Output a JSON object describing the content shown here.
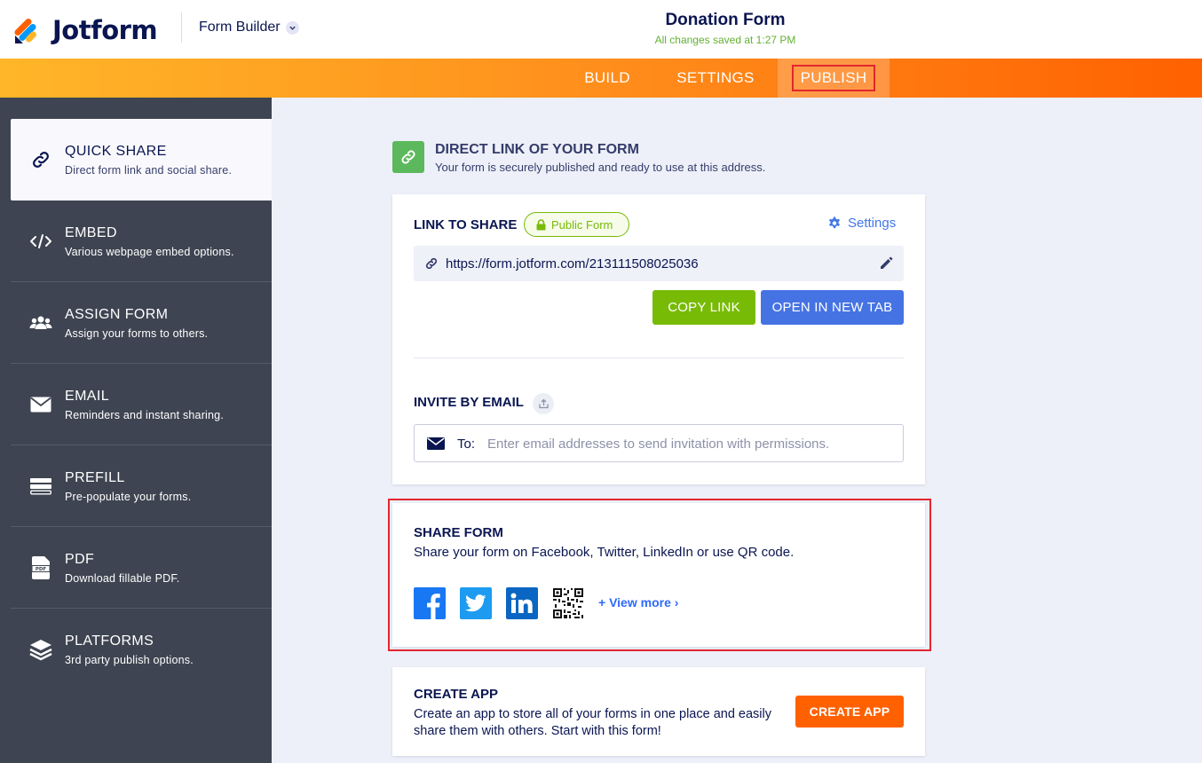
{
  "header": {
    "logo_text": "Jotform",
    "mode_label": "Form Builder",
    "form_title": "Donation Form",
    "save_status": "All changes saved at 1:27 PM"
  },
  "nav": {
    "tabs": [
      {
        "label": "BUILD"
      },
      {
        "label": "SETTINGS"
      },
      {
        "label": "PUBLISH",
        "active": true
      }
    ]
  },
  "sidebar": {
    "items": [
      {
        "title": "QUICK SHARE",
        "subtitle": "Direct form link and social share.",
        "icon": "link-icon",
        "active": true
      },
      {
        "title": "EMBED",
        "subtitle": "Various webpage embed options.",
        "icon": "code-icon"
      },
      {
        "title": "ASSIGN FORM",
        "subtitle": "Assign your forms to others.",
        "icon": "users-icon"
      },
      {
        "title": "EMAIL",
        "subtitle": "Reminders and instant sharing.",
        "icon": "envelope-icon"
      },
      {
        "title": "PREFILL",
        "subtitle": "Pre-populate your forms.",
        "icon": "prefill-icon"
      },
      {
        "title": "PDF",
        "subtitle": "Download fillable PDF.",
        "icon": "pdf-icon"
      },
      {
        "title": "PLATFORMS",
        "subtitle": "3rd party publish options.",
        "icon": "layers-icon"
      }
    ]
  },
  "direct_link": {
    "title": "DIRECT LINK OF YOUR FORM",
    "subtitle": "Your form is securely published and ready to use at this address."
  },
  "link_card": {
    "label": "LINK TO SHARE",
    "badge": "Public Form",
    "settings_label": "Settings",
    "url": "https://form.jotform.com/213111508025036",
    "copy_label": "COPY LINK",
    "open_label": "OPEN IN NEW TAB",
    "invite_label": "INVITE BY EMAIL",
    "email_to": "To:",
    "email_placeholder": "Enter email addresses to send invitation with permissions."
  },
  "share_card": {
    "title": "SHARE FORM",
    "subtitle": "Share your form on Facebook, Twitter, LinkedIn or use QR code.",
    "view_more": "View more"
  },
  "app_card": {
    "title": "CREATE APP",
    "description": "Create an app to store all of your forms in one place and easily share them with others. Start with this form!",
    "button_label": "CREATE APP"
  },
  "colors": {
    "accent_orange": "#ff6100",
    "green": "#78bb07",
    "blue": "#4573e3",
    "sidebar_bg": "#3e4451",
    "highlight_red": "#e3262f"
  }
}
